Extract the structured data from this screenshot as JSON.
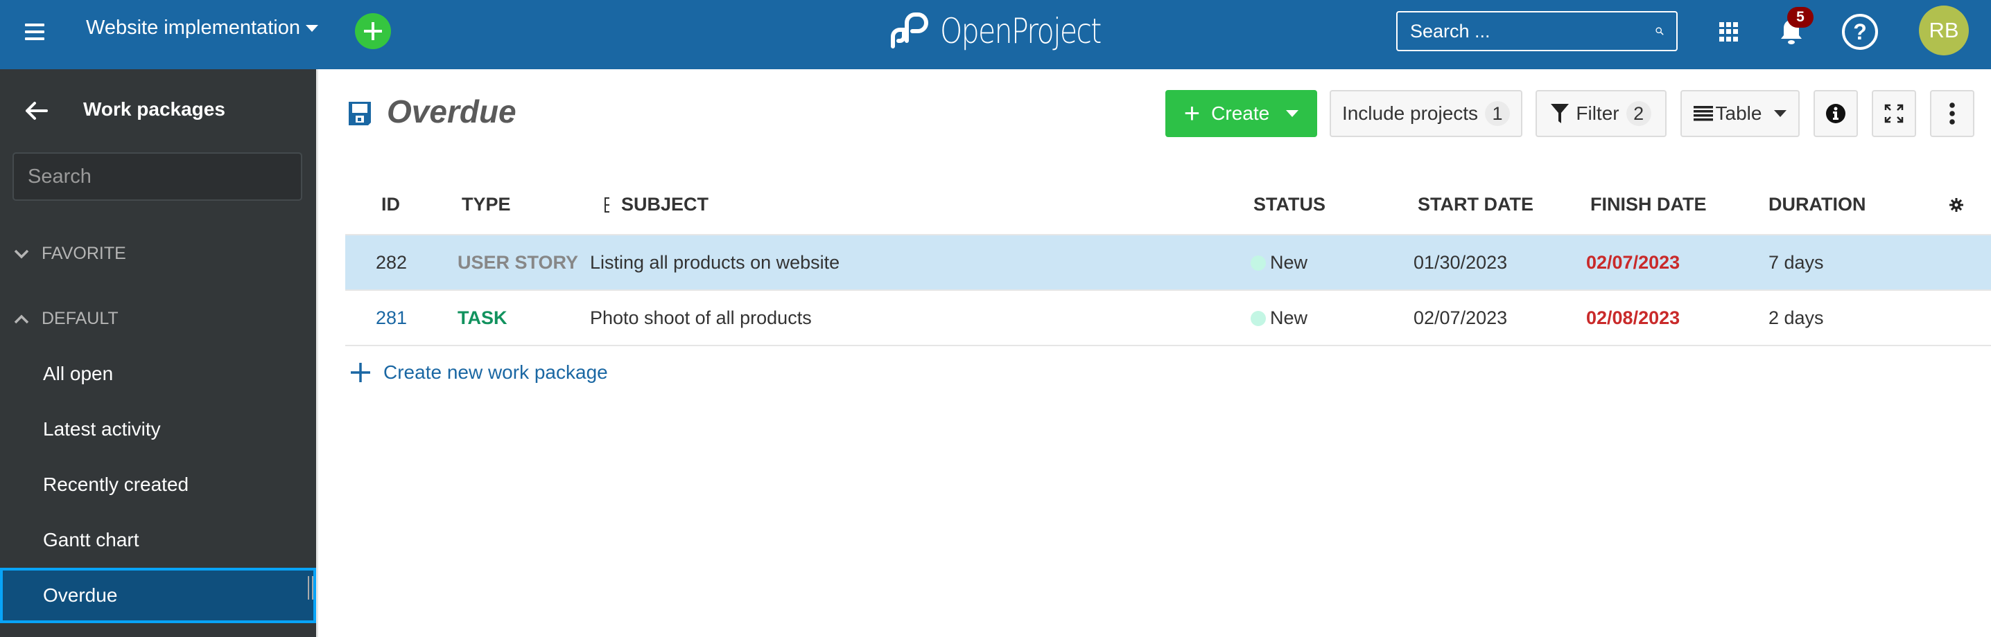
{
  "header": {
    "project_name": "Website implementation",
    "logo_text": "OpenProject",
    "search_placeholder": "Search ...",
    "notification_count": "5",
    "help_label": "?",
    "avatar_initials": "RB",
    "colors": {
      "header_bg": "#1a67a3",
      "quick_add": "#35c53f",
      "badge": "#8b0000",
      "avatar": "#b1c04e"
    }
  },
  "sidebar": {
    "title": "Work packages",
    "search_placeholder": "Search",
    "groups": [
      {
        "label": "FAVORITE",
        "expanded": false
      },
      {
        "label": "DEFAULT",
        "expanded": true
      }
    ],
    "items": [
      {
        "label": "All open",
        "active": false
      },
      {
        "label": "Latest activity",
        "active": false
      },
      {
        "label": "Recently created",
        "active": false
      },
      {
        "label": "Gantt chart",
        "active": false
      },
      {
        "label": "Overdue",
        "active": true
      }
    ]
  },
  "toolbar": {
    "title": "Overdue",
    "create_label": "Create",
    "include_projects_label": "Include projects",
    "include_projects_count": "1",
    "filter_label": "Filter",
    "filter_count": "2",
    "view_label": "Table"
  },
  "table": {
    "columns": [
      "ID",
      "TYPE",
      "SUBJECT",
      "STATUS",
      "START DATE",
      "FINISH DATE",
      "DURATION"
    ],
    "rows": [
      {
        "id": "282",
        "type": "USER STORY",
        "subject": "Listing all products on website",
        "status": "New",
        "start_date": "01/30/2023",
        "finish_date": "02/07/2023",
        "duration": "7 days",
        "selected": true
      },
      {
        "id": "281",
        "type": "TASK",
        "subject": "Photo shoot of all products",
        "status": "New",
        "start_date": "02/07/2023",
        "finish_date": "02/08/2023",
        "duration": "2 days",
        "selected": false
      }
    ],
    "create_new_label": "Create new work package"
  }
}
